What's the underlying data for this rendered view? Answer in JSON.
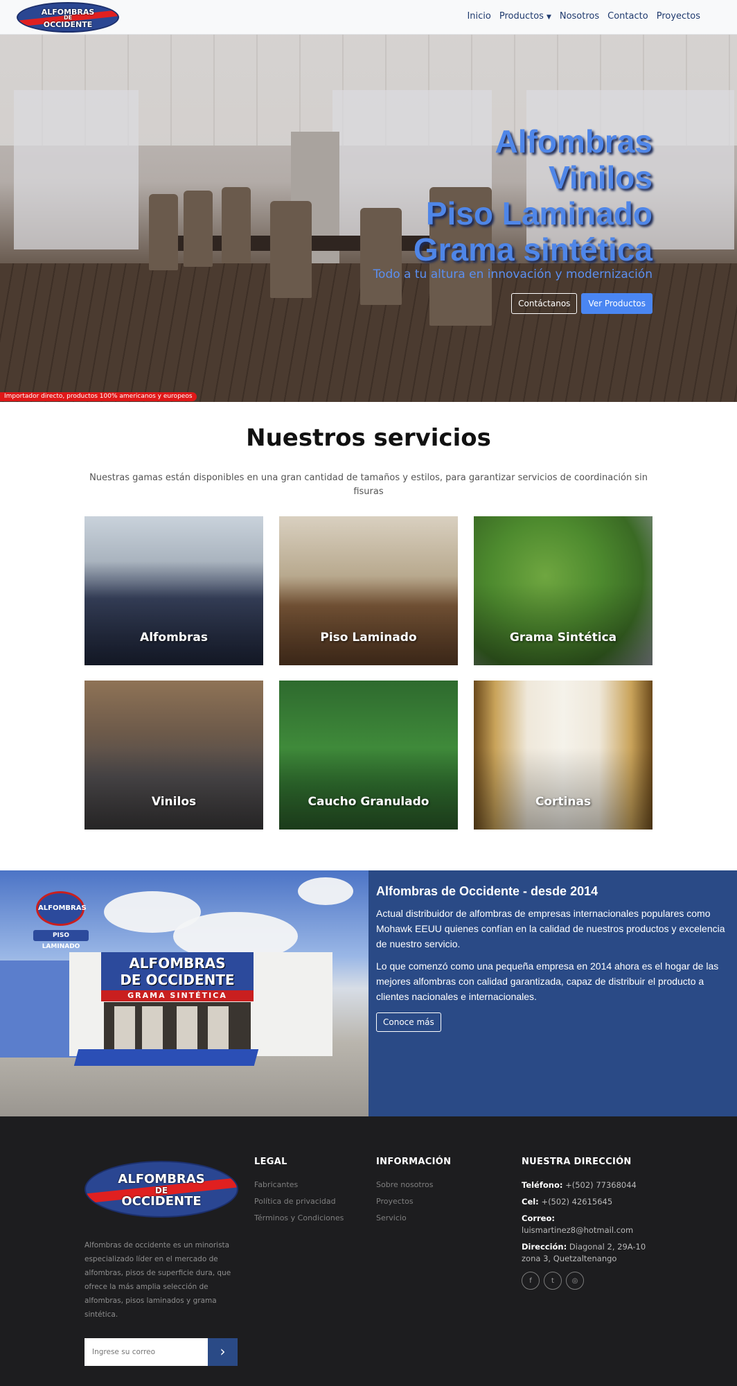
{
  "brand": {
    "logo_line1": "ALFOMBRAS",
    "logo_line2": "DE",
    "logo_line3": "OCCIDENTE",
    "primary_color": "#2a4a86",
    "accent_blue": "#4a86f2",
    "logo_red": "#e02020"
  },
  "nav": {
    "items": [
      {
        "label": "Inicio"
      },
      {
        "label": "Productos",
        "dropdown": true
      },
      {
        "label": "Nosotros"
      },
      {
        "label": "Contacto"
      },
      {
        "label": "Proyectos"
      }
    ]
  },
  "hero": {
    "titles": [
      "Alfombras",
      "Vinilos",
      "Piso Laminado",
      "Grama sintética"
    ],
    "subtitle": "Todo a tu altura en innovación y modernización",
    "button_contact": "Contáctanos",
    "button_products": "Ver Productos",
    "badge": "Importador directo, productos 100% americanos y europeos"
  },
  "services": {
    "title": "Nuestros servicios",
    "description": "Nuestras gamas están disponibles en una gran cantidad de tamaños y estilos, para garantizar servicios de coordinación sin fisuras",
    "cards": [
      {
        "label": "Alfombras"
      },
      {
        "label": "Piso Laminado"
      },
      {
        "label": "Grama Sintética"
      },
      {
        "label": "Vinilos"
      },
      {
        "label": "Caucho Granulado"
      },
      {
        "label": "Cortinas"
      }
    ]
  },
  "about": {
    "heading": "Alfombras de Occidente - desde 2014",
    "paragraph1": "Actual distribuidor de alfombras de empresas internacionales populares como Mohawk EEUU quienes confían en la calidad de nuestros productos y excelencia de nuestro servicio.",
    "paragraph2": "Lo que comenzó como una pequeña empresa en 2014 ahora es el hogar de las mejores alfombras con calidad garantizada, capaz de distribuir el producto a clientes nacionales e internacionales.",
    "button": "Conoce más",
    "store_sign_line1": "ALFOMBRAS",
    "store_sign_line2": "DE OCCIDENTE",
    "store_band": "GRAMA SINTÉTICA",
    "pole_sign": "ALFOMBRAS",
    "pole_sign2": "PISO LAMINADO"
  },
  "footer": {
    "about_text": "Alfombras de occidente es un minorista especializado líder en el mercado de alfombras, pisos de superficie dura, que ofrece la más amplia selección de alfombras, pisos laminados y grama sintética.",
    "subscribe_placeholder": "Ingrese su correo",
    "legal": {
      "title": "LEGAL",
      "links": [
        "Fabricantes",
        "Política de privacidad",
        "Términos y Condiciones"
      ]
    },
    "info": {
      "title": "INFORMACIÓN",
      "links": [
        "Sobre nosotros",
        "Proyectos",
        "Servicio"
      ]
    },
    "address": {
      "title": "NUESTRA DIRECCIÓN",
      "phone_label": "Teléfono:",
      "phone": "+(502) 77368044",
      "cel_label": "Cel:",
      "cel": "+(502) 42615645",
      "email_label": "Correo:",
      "email": "luismartinez8@hotmail.com",
      "direccion_label": "Dirección:",
      "direccion": "Diagonal 2, 29A-10 zona 3, Quetzaltenango"
    },
    "social_icons": [
      "facebook-icon",
      "twitter-icon",
      "instagram-icon"
    ]
  }
}
